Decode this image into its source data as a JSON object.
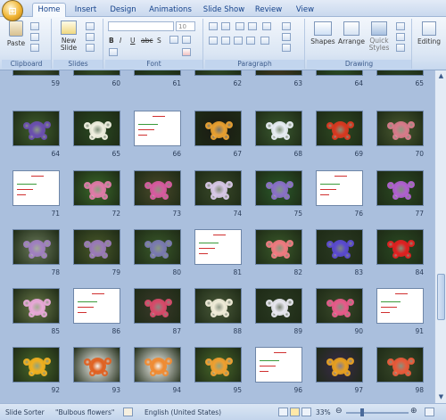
{
  "app": {
    "office_button_glyph": "⊞"
  },
  "tabs": [
    "Home",
    "Insert",
    "Design",
    "Animations",
    "Slide Show",
    "Review",
    "View"
  ],
  "ribbon": {
    "groups": {
      "clipboard": "Clipboard",
      "slides": "Slides",
      "font": "Font",
      "paragraph": "Paragraph",
      "drawing": "Drawing"
    },
    "paste_label": "Paste",
    "new_slide_label": "New Slide",
    "font_size": "10",
    "shapes_label": "Shapes",
    "arrange_label": "Arrange",
    "quick_styles_label": "Quick Styles",
    "editing_label": "Editing",
    "bold_label": "B",
    "italic_label": "I",
    "underline_label": "U",
    "strike_label": "abc",
    "shadow_label": "S"
  },
  "slides": [
    {
      "n": "59",
      "kind": "photo",
      "bg": "#4a5a3a",
      "accent": "#8a6ab0"
    },
    {
      "n": "60",
      "kind": "photo",
      "bg": "#3c5a2c",
      "accent": "#9a7ac8"
    },
    {
      "n": "61",
      "kind": "photo",
      "bg": "#2a4a24",
      "accent": "#e7e3f0"
    },
    {
      "n": "62",
      "kind": "photo",
      "bg": "#35552a",
      "accent": "#d8c8e6"
    },
    {
      "n": "63",
      "kind": "photo",
      "bg": "#4a3a20",
      "accent": "#c8b8a0"
    },
    {
      "n": "64",
      "kind": "photo",
      "bg": "#2e5a2a",
      "accent": "#e6d6ee"
    },
    {
      "n": "65",
      "kind": "photo",
      "bg": "#2c4a26",
      "accent": "#6a7a50"
    },
    {
      "n": "64",
      "kind": "photo",
      "bg": "#40602e",
      "accent": "#6b4fb0"
    },
    {
      "n": "65",
      "kind": "photo",
      "bg": "#2a4a22",
      "accent": "#f0f0e0"
    },
    {
      "n": "66",
      "kind": "text",
      "bg": "#ffffff",
      "accent": "#d03030"
    },
    {
      "n": "67",
      "kind": "photo",
      "bg": "#1a1a12",
      "accent": "#e8a030"
    },
    {
      "n": "68",
      "kind": "photo",
      "bg": "#3a5a30",
      "accent": "#e8eef4"
    },
    {
      "n": "69",
      "kind": "photo",
      "bg": "#2e4a22",
      "accent": "#d83820"
    },
    {
      "n": "70",
      "kind": "photo",
      "bg": "#4a5a30",
      "accent": "#d87a8a"
    },
    {
      "n": "71",
      "kind": "text",
      "bg": "#ffffff",
      "accent": "#d03030"
    },
    {
      "n": "72",
      "kind": "photo",
      "bg": "#3a6a2a",
      "accent": "#e07aa8"
    },
    {
      "n": "73",
      "kind": "photo",
      "bg": "#4a4a2a",
      "accent": "#d85aa0"
    },
    {
      "n": "74",
      "kind": "photo",
      "bg": "#3a4a2a",
      "accent": "#d8c8e8"
    },
    {
      "n": "75",
      "kind": "photo",
      "bg": "#2a5a2a",
      "accent": "#8a70c8"
    },
    {
      "n": "76",
      "kind": "text",
      "bg": "#ffffff",
      "accent": "#d03030"
    },
    {
      "n": "77",
      "kind": "photo",
      "bg": "#2a4a22",
      "accent": "#b060d0"
    },
    {
      "n": "78",
      "kind": "photo",
      "bg": "#6a7a5a",
      "accent": "#a080c0"
    },
    {
      "n": "79",
      "kind": "photo",
      "bg": "#4a5a2a",
      "accent": "#9a7ab8"
    },
    {
      "n": "80",
      "kind": "photo",
      "bg": "#3a5a2a",
      "accent": "#7a7ab0"
    },
    {
      "n": "81",
      "kind": "text",
      "bg": "#ffffff",
      "accent": "#d03030"
    },
    {
      "n": "82",
      "kind": "photo",
      "bg": "#3a5a2a",
      "accent": "#f07a80"
    },
    {
      "n": "83",
      "kind": "photo",
      "bg": "#2a3a22",
      "accent": "#5a4ad0"
    },
    {
      "n": "84",
      "kind": "photo",
      "bg": "#2a4a22",
      "accent": "#e02020"
    },
    {
      "n": "85",
      "kind": "photo",
      "bg": "#6a7a4a",
      "accent": "#e8a8d8"
    },
    {
      "n": "86",
      "kind": "text",
      "bg": "#ffffff",
      "accent": "#d03030"
    },
    {
      "n": "87",
      "kind": "photo",
      "bg": "#3a3a2a",
      "accent": "#d84a6a"
    },
    {
      "n": "88",
      "kind": "photo",
      "bg": "#4a5a3a",
      "accent": "#f0ecd8"
    },
    {
      "n": "89",
      "kind": "photo",
      "bg": "#2a3a22",
      "accent": "#e8e8f0"
    },
    {
      "n": "90",
      "kind": "photo",
      "bg": "#3a4a2a",
      "accent": "#e85a8a"
    },
    {
      "n": "91",
      "kind": "text",
      "bg": "#ffffff",
      "accent": "#d03030"
    },
    {
      "n": "92",
      "kind": "photo",
      "bg": "#4a6a2a",
      "accent": "#f0b020"
    },
    {
      "n": "93",
      "kind": "photo",
      "bg": "#f4f4f0",
      "accent": "#e06020"
    },
    {
      "n": "94",
      "kind": "photo",
      "bg": "#f4f4f0",
      "accent": "#f08a30"
    },
    {
      "n": "95",
      "kind": "photo",
      "bg": "#4a6a2a",
      "accent": "#f0a030"
    },
    {
      "n": "96",
      "kind": "text",
      "bg": "#ffffff",
      "accent": "#d03030"
    },
    {
      "n": "97",
      "kind": "photo",
      "bg": "#3a2a4a",
      "accent": "#e8a020"
    },
    {
      "n": "98",
      "kind": "photo",
      "bg": "#3a4a2a",
      "accent": "#e85a3a"
    }
  ],
  "status": {
    "view": "Slide Sorter",
    "theme": "\"Bulbous flowers\"",
    "language": "English (United States)",
    "zoom": "33%"
  }
}
